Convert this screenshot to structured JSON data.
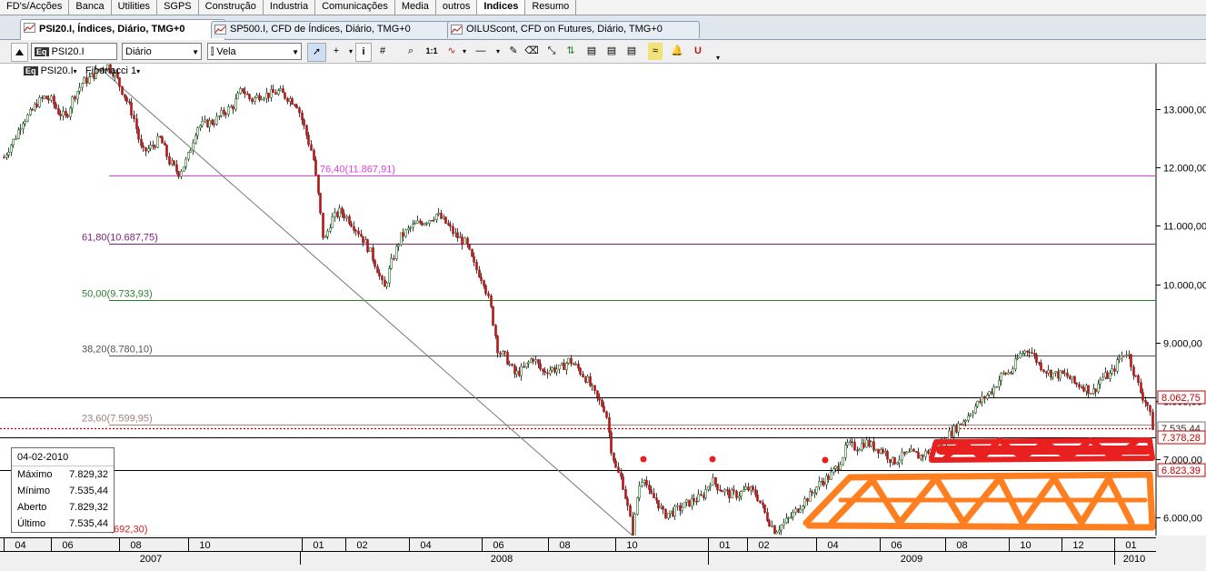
{
  "nav": {
    "tabs": [
      "FD's/Acções",
      "Banca",
      "Utilities",
      "SGPS",
      "Construção",
      "Industria",
      "Comunicações",
      "Media",
      "outros",
      "Indices",
      "Resumo"
    ],
    "active_index": 9
  },
  "chart_tabs": [
    {
      "label": "PSI20.I, Índices, Diário, TMG+0",
      "active": true
    },
    {
      "label": "SP500.I, CFD de Índices, Diário, TMG+0",
      "active": false
    },
    {
      "label": "OILUScont, CFD on Futures, Diário, TMG+0",
      "active": false
    }
  ],
  "toolbar": {
    "symbol_badge": "Eq",
    "symbol_value": "PSI20.I",
    "period_value": "Diário",
    "chart_type_value": "Vela",
    "scale_label": "1:1"
  },
  "chart_header": {
    "symbol": "PSI20.I",
    "study": "Fibonacci 1"
  },
  "info_box": {
    "date": "04-02-2010",
    "rows": [
      {
        "label": "Máximo",
        "value": "7.829,32"
      },
      {
        "label": "Mínimo",
        "value": "7.535,44"
      },
      {
        "label": "Aberto",
        "value": "7.829,32"
      },
      {
        "label": "Último",
        "value": "7.535,44"
      }
    ]
  },
  "colors": {
    "up_candle": "#1e6b1e",
    "down_candle": "#b01818",
    "fib_764": "#e040e0",
    "fib_618": "#7a1f7a",
    "fib_500": "#2e7d2e",
    "fib_382": "#555555",
    "fib_236": "#a08080",
    "fib_0": "#d02020",
    "last_price": "#c00000",
    "highlight_red": "#e82020",
    "highlight_orange": "#ff7f20"
  },
  "chart_data": {
    "type": "candlestick",
    "title": "PSI20.I",
    "y_axis": {
      "range": [
        5600,
        13800
      ],
      "ticks": [
        "6.000,00",
        "7.000,00",
        "8.000,00",
        "9.000,00",
        "10.000,00",
        "11.000,00",
        "12.000,00",
        "13.000,00"
      ],
      "tick_values": [
        6000,
        7000,
        8000,
        9000,
        10000,
        11000,
        12000,
        13000
      ]
    },
    "x_axis": {
      "month_ticks": [
        "04",
        "06",
        "08",
        "10",
        "01",
        "02",
        "04",
        "06",
        "08",
        "10",
        "01",
        "02",
        "04",
        "06",
        "08",
        "10",
        "12",
        "01"
      ],
      "years": [
        "2007",
        "2008",
        "2009",
        "2010"
      ]
    },
    "fibonacci": [
      {
        "label": "76,40(11.867,91)",
        "value": 11867.91
      },
      {
        "label": "61,80(10.687,75)",
        "value": 10687.75
      },
      {
        "label": "50,00(9.733,93)",
        "value": 9733.93
      },
      {
        "label": "38,20(8.780,10)",
        "value": 8780.1
      },
      {
        "label": "23,60(7.599,95)",
        "value": 7599.95
      },
      {
        "label": ",692,30)",
        "value": 5692.3
      }
    ],
    "horizontal_lines": [
      8062.75,
      7378.28,
      6823.39
    ],
    "price_labels": [
      {
        "label": "8.062,75",
        "value": 8062.75
      },
      {
        "label": "7.535,44",
        "value": 7535.44
      },
      {
        "label": "7.378,28",
        "value": 7378.28
      },
      {
        "label": "6.823,39",
        "value": 6823.39
      }
    ],
    "last_price": 7535.44,
    "price_path": [
      [
        0,
        12050
      ],
      [
        8,
        12300
      ],
      [
        16,
        12500
      ],
      [
        24,
        12800
      ],
      [
        32,
        12900
      ],
      [
        40,
        13100
      ],
      [
        48,
        13200
      ],
      [
        56,
        13150
      ],
      [
        64,
        12950
      ],
      [
        72,
        12850
      ],
      [
        80,
        13200
      ],
      [
        90,
        13450
      ],
      [
        100,
        13550
      ],
      [
        110,
        13700
      ],
      [
        118,
        13750
      ],
      [
        126,
        13600
      ],
      [
        136,
        13250
      ],
      [
        146,
        12900
      ],
      [
        156,
        12250
      ],
      [
        166,
        12350
      ],
      [
        176,
        12500
      ],
      [
        186,
        12100
      ],
      [
        196,
        11900
      ],
      [
        206,
        12150
      ],
      [
        216,
        12700
      ],
      [
        226,
        12750
      ],
      [
        236,
        12800
      ],
      [
        246,
        12950
      ],
      [
        256,
        13050
      ],
      [
        266,
        13350
      ],
      [
        276,
        13150
      ],
      [
        286,
        13250
      ],
      [
        296,
        13250
      ],
      [
        306,
        13300
      ],
      [
        316,
        13200
      ],
      [
        326,
        13100
      ],
      [
        336,
        12600
      ],
      [
        344,
        12200
      ],
      [
        350,
        11500
      ],
      [
        356,
        10700
      ],
      [
        364,
        11100
      ],
      [
        374,
        11250
      ],
      [
        384,
        11100
      ],
      [
        394,
        10900
      ],
      [
        404,
        10650
      ],
      [
        414,
        10300
      ],
      [
        422,
        9900
      ],
      [
        430,
        10350
      ],
      [
        440,
        10800
      ],
      [
        450,
        10950
      ],
      [
        460,
        11050
      ],
      [
        470,
        11100
      ],
      [
        480,
        11200
      ],
      [
        490,
        11050
      ],
      [
        500,
        10850
      ],
      [
        512,
        10700
      ],
      [
        522,
        10300
      ],
      [
        532,
        10050
      ],
      [
        540,
        9550
      ],
      [
        548,
        8850
      ],
      [
        556,
        8750
      ],
      [
        566,
        8450
      ],
      [
        576,
        8550
      ],
      [
        586,
        8750
      ],
      [
        596,
        8500
      ],
      [
        606,
        8550
      ],
      [
        616,
        8550
      ],
      [
        626,
        8700
      ],
      [
        636,
        8550
      ],
      [
        646,
        8350
      ],
      [
        656,
        8050
      ],
      [
        666,
        7850
      ],
      [
        672,
        7200
      ],
      [
        678,
        6800
      ],
      [
        684,
        6650
      ],
      [
        690,
        6200
      ],
      [
        696,
        5720
      ],
      [
        702,
        6500
      ],
      [
        708,
        6750
      ],
      [
        714,
        6400
      ],
      [
        722,
        6300
      ],
      [
        730,
        6050
      ],
      [
        740,
        6100
      ],
      [
        752,
        6200
      ],
      [
        762,
        6300
      ],
      [
        772,
        6350
      ],
      [
        782,
        6650
      ],
      [
        792,
        6500
      ],
      [
        802,
        6400
      ],
      [
        812,
        6400
      ],
      [
        822,
        6500
      ],
      [
        832,
        6400
      ],
      [
        842,
        6050
      ],
      [
        852,
        5780
      ],
      [
        862,
        5900
      ],
      [
        872,
        6050
      ],
      [
        882,
        6250
      ],
      [
        892,
        6400
      ],
      [
        902,
        6600
      ],
      [
        912,
        6700
      ],
      [
        922,
        6900
      ],
      [
        932,
        7250
      ],
      [
        942,
        7200
      ],
      [
        952,
        7300
      ],
      [
        962,
        7200
      ],
      [
        972,
        7150
      ],
      [
        982,
        6950
      ],
      [
        992,
        7050
      ],
      [
        1002,
        7100
      ],
      [
        1012,
        7050
      ],
      [
        1022,
        7150
      ],
      [
        1032,
        7250
      ],
      [
        1042,
        7400
      ],
      [
        1052,
        7550
      ],
      [
        1062,
        7700
      ],
      [
        1072,
        7900
      ],
      [
        1082,
        8050
      ],
      [
        1092,
        8200
      ],
      [
        1102,
        8450
      ],
      [
        1112,
        8500
      ],
      [
        1122,
        8800
      ],
      [
        1132,
        8900
      ],
      [
        1142,
        8650
      ],
      [
        1152,
        8500
      ],
      [
        1162,
        8450
      ],
      [
        1172,
        8450
      ],
      [
        1182,
        8300
      ],
      [
        1192,
        8250
      ],
      [
        1202,
        8150
      ],
      [
        1212,
        8400
      ],
      [
        1222,
        8450
      ],
      [
        1232,
        8750
      ],
      [
        1240,
        8850
      ],
      [
        1248,
        8450
      ],
      [
        1256,
        8100
      ],
      [
        1262,
        7950
      ],
      [
        1268,
        7535
      ]
    ],
    "fib_trendline": {
      "from": [
        110,
        13700
      ],
      "to": [
        696,
        5692
      ]
    }
  }
}
